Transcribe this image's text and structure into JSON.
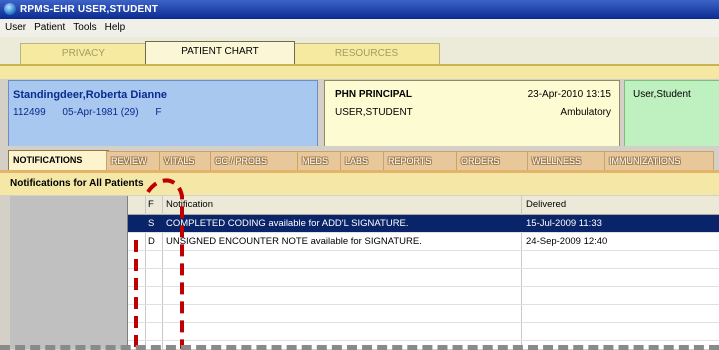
{
  "window": {
    "title": "RPMS-EHR USER,STUDENT"
  },
  "menu": [
    "User",
    "Patient",
    "Tools",
    "Help"
  ],
  "top_tabs": [
    {
      "label": "PRIVACY",
      "active": false
    },
    {
      "label": "PATIENT CHART",
      "active": true
    },
    {
      "label": "RESOURCES",
      "active": false
    }
  ],
  "patient": {
    "name": "Standingdeer,Roberta Dianne",
    "id": "112499",
    "dob": "05-Apr-1981 (29)",
    "sex": "F"
  },
  "visit": {
    "title": "PHN PRINCIPAL",
    "user": "USER,STUDENT",
    "datetime": "23-Apr-2010 13:15",
    "type": "Ambulatory"
  },
  "provider": {
    "label": "User,Student"
  },
  "chart_tabs": [
    {
      "label": "NOTIFICATIONS",
      "active": true
    },
    {
      "label": "REVIEW",
      "active": false
    },
    {
      "label": "VITALS",
      "active": false
    },
    {
      "label": "CC / PROBS",
      "active": false
    },
    {
      "label": "MEDS",
      "active": false
    },
    {
      "label": "LABS",
      "active": false
    },
    {
      "label": "REPORTS",
      "active": false
    },
    {
      "label": "ORDERS",
      "active": false
    },
    {
      "label": "WELLNESS",
      "active": false
    },
    {
      "label": "IMMUNIZATIONS",
      "active": false
    }
  ],
  "notifications": {
    "header": "Notifications for All Patients",
    "columns": {
      "flag": "F",
      "notification": "Notification",
      "delivered": "Delivered"
    },
    "rows": [
      {
        "flag": "S",
        "text": "COMPLETED CODING available for ADD'L SIGNATURE.",
        "delivered": "15-Jul-2009 11:33",
        "selected": true
      },
      {
        "flag": "D",
        "text": "UNSIGNED ENCOUNTER NOTE available for SIGNATURE.",
        "delivered": "24-Sep-2009 12:40",
        "selected": false
      }
    ]
  },
  "colors": {
    "title_bar": "#0a2a8f",
    "selection": "#0a246a",
    "annotation": "#c00000"
  }
}
